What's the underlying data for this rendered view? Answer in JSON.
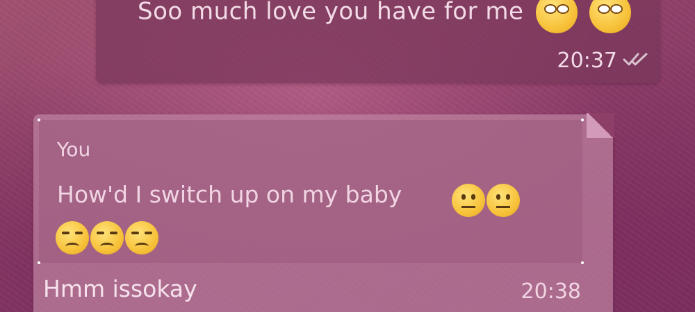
{
  "chat": {
    "messages": [
      {
        "id": "outgoing-1",
        "text": "Soo much love you have for me",
        "emojis": [
          "rolling-eyes-emoji",
          "rolling-eyes-emoji"
        ],
        "time": "20:37",
        "status_icon": "double-check-icon"
      },
      {
        "id": "incoming-reply-1",
        "quote": {
          "author": "You",
          "text": "How'd I switch up on my baby",
          "emojis_line1": [
            "neutral-face-emoji",
            "neutral-face-emoji"
          ],
          "emojis_line2": [
            "unamused-face-emoji",
            "unamused-face-emoji",
            "unamused-face-emoji"
          ]
        },
        "text": "Hmm issokay",
        "time": "20:38"
      }
    ]
  },
  "colors": {
    "background": "#8e3f68",
    "outgoing_bubble": "#78375a",
    "incoming_bubble": "#be82a0",
    "quote_bubble": "#a05f82",
    "text": "#f3dbe7",
    "emoji_yellow": "#f7c23a"
  }
}
